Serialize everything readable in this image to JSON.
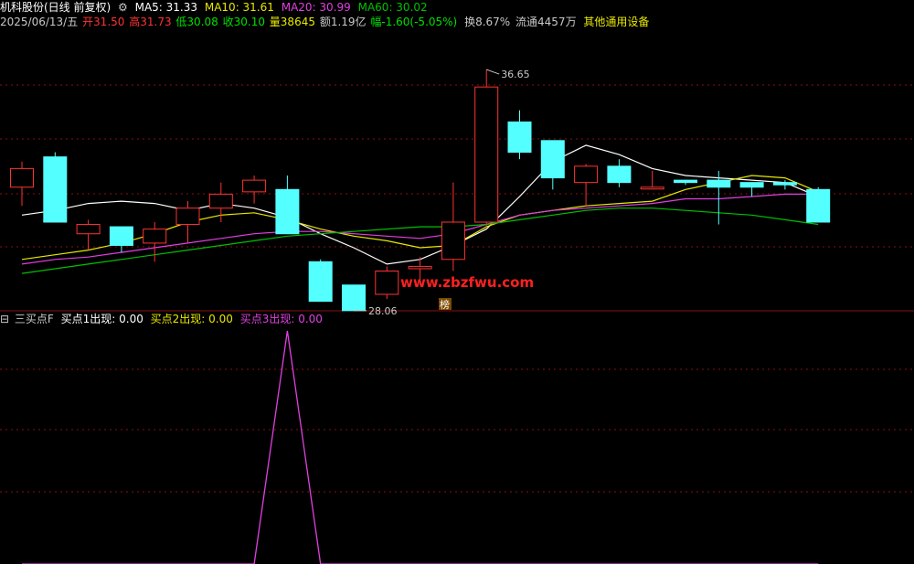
{
  "header": {
    "stock_title": "机科股份(日线 前复权)",
    "ma_indicator_label": "MA5: 31.33",
    "ma5": "MA5: 31.33",
    "ma10": "MA10: 31.61",
    "ma20": "MA20: 30.99",
    "ma60": "MA60: 30.02"
  },
  "quote": {
    "date": "2025/06/13/五",
    "open": "开31.50",
    "high": "高31.73",
    "low": "低30.08",
    "close": "收30.10",
    "volume": "量38645",
    "amount": "额1.19亿",
    "change": "幅-1.60(-5.05%)",
    "turnover": "换8.67%",
    "float_shares": "流通4457万",
    "industry": "其他通用设备"
  },
  "sub_indicator": {
    "name": "三买点F",
    "buy1": "买点1出现: 0.00",
    "buy2": "买点2出现: 0.00",
    "buy3": "买点3出现: 0.00"
  },
  "annotations": {
    "high_label": "36.65",
    "low_label": "28.06",
    "badge": "榜",
    "watermark": "www.zbzfwu.com"
  },
  "colors": {
    "up": "#ff3232",
    "down": "#54ffff",
    "ma5": "#ffffff",
    "ma10": "#e8e800",
    "ma20": "#e040e0",
    "ma60": "#00c000",
    "grid": "#8a1010",
    "watermark": "#ff2020",
    "buy3_line": "#e040e0"
  },
  "chart_data": [
    {
      "type": "candlestick",
      "ylim": [
        27.0,
        38.3
      ],
      "candles": [
        {
          "o": 31.6,
          "h": 32.7,
          "l": 30.8,
          "c": 32.4
        },
        {
          "o": 32.9,
          "h": 33.1,
          "l": 30.1,
          "c": 30.1
        },
        {
          "o": 29.6,
          "h": 30.2,
          "l": 28.9,
          "c": 30.0
        },
        {
          "o": 29.9,
          "h": 29.9,
          "l": 28.8,
          "c": 29.1
        },
        {
          "o": 29.2,
          "h": 30.1,
          "l": 28.4,
          "c": 29.8
        },
        {
          "o": 30.0,
          "h": 31.0,
          "l": 29.2,
          "c": 30.7
        },
        {
          "o": 30.7,
          "h": 31.8,
          "l": 30.1,
          "c": 31.3
        },
        {
          "o": 31.4,
          "h": 32.1,
          "l": 30.9,
          "c": 31.9
        },
        {
          "o": 31.5,
          "h": 32.1,
          "l": 29.6,
          "c": 29.6
        },
        {
          "o": 28.4,
          "h": 28.5,
          "l": 26.7,
          "c": 26.7
        },
        {
          "o": 27.4,
          "h": 27.4,
          "l": 26.3,
          "c": 26.3
        },
        {
          "o": 27.0,
          "h": 28.2,
          "l": 26.8,
          "c": 28.0
        },
        {
          "o": 28.1,
          "h": 28.6,
          "l": 27.4,
          "c": 28.2
        },
        {
          "o": 28.5,
          "h": 31.8,
          "l": 28.0,
          "c": 30.1
        },
        {
          "o": 30.1,
          "h": 36.65,
          "l": 29.9,
          "c": 35.9
        },
        {
          "o": 34.4,
          "h": 34.9,
          "l": 32.8,
          "c": 33.1
        },
        {
          "o": 33.6,
          "h": 33.6,
          "l": 31.5,
          "c": 32.0
        },
        {
          "o": 31.8,
          "h": 32.6,
          "l": 30.8,
          "c": 32.5
        },
        {
          "o": 32.5,
          "h": 32.8,
          "l": 31.6,
          "c": 31.8
        },
        {
          "o": 31.6,
          "h": 32.3,
          "l": 31.5,
          "c": 31.6
        },
        {
          "o": 31.9,
          "h": 31.9,
          "l": 31.7,
          "c": 31.8
        },
        {
          "o": 31.9,
          "h": 32.3,
          "l": 30.0,
          "c": 31.6
        },
        {
          "o": 31.8,
          "h": 31.8,
          "l": 31.2,
          "c": 31.6
        },
        {
          "o": 31.8,
          "h": 31.9,
          "l": 31.5,
          "c": 31.7
        },
        {
          "o": 31.5,
          "h": 31.6,
          "l": 30.1,
          "c": 30.1
        }
      ],
      "series": [
        {
          "name": "MA5",
          "values": [
            30.4,
            30.6,
            30.9,
            31.0,
            30.9,
            30.6,
            30.9,
            30.7,
            30.3,
            29.6,
            29.0,
            28.3,
            28.5,
            29.1,
            29.8,
            31.2,
            32.7,
            33.4,
            33.0,
            32.4,
            32.1,
            32.0,
            31.9,
            31.8,
            31.2
          ]
        },
        {
          "name": "MA10",
          "values": [
            28.5,
            28.7,
            28.9,
            29.2,
            29.6,
            30.1,
            30.4,
            30.5,
            30.2,
            29.8,
            29.5,
            29.3,
            29.0,
            29.1,
            29.9,
            30.4,
            30.6,
            30.8,
            30.9,
            31.0,
            31.5,
            31.8,
            32.1,
            32.0,
            31.4
          ]
        },
        {
          "name": "MA20",
          "values": [
            28.3,
            28.5,
            28.6,
            28.8,
            29.0,
            29.2,
            29.4,
            29.6,
            29.7,
            29.7,
            29.6,
            29.5,
            29.4,
            29.6,
            30.0,
            30.4,
            30.6,
            30.7,
            30.8,
            30.9,
            31.1,
            31.1,
            31.2,
            31.3,
            31.3
          ]
        },
        {
          "name": "MA60",
          "values": [
            27.9,
            28.1,
            28.3,
            28.5,
            28.7,
            28.9,
            29.1,
            29.3,
            29.5,
            29.6,
            29.7,
            29.8,
            29.9,
            29.9,
            30.0,
            30.2,
            30.4,
            30.6,
            30.7,
            30.7,
            30.6,
            30.5,
            30.4,
            30.2,
            30.0
          ]
        }
      ],
      "marks": [
        {
          "candle": 14,
          "label": "36.65"
        },
        {
          "candle": 10,
          "label": "28.06"
        }
      ]
    },
    {
      "type": "line",
      "series": [
        {
          "name": "买点3出现",
          "values": [
            0,
            0,
            0,
            0,
            0,
            0,
            0,
            0,
            1,
            0,
            0,
            0,
            0,
            0,
            0,
            0,
            0,
            0,
            0,
            0,
            0,
            0,
            0,
            0,
            0
          ]
        }
      ],
      "ylim": [
        0,
        1
      ]
    }
  ]
}
